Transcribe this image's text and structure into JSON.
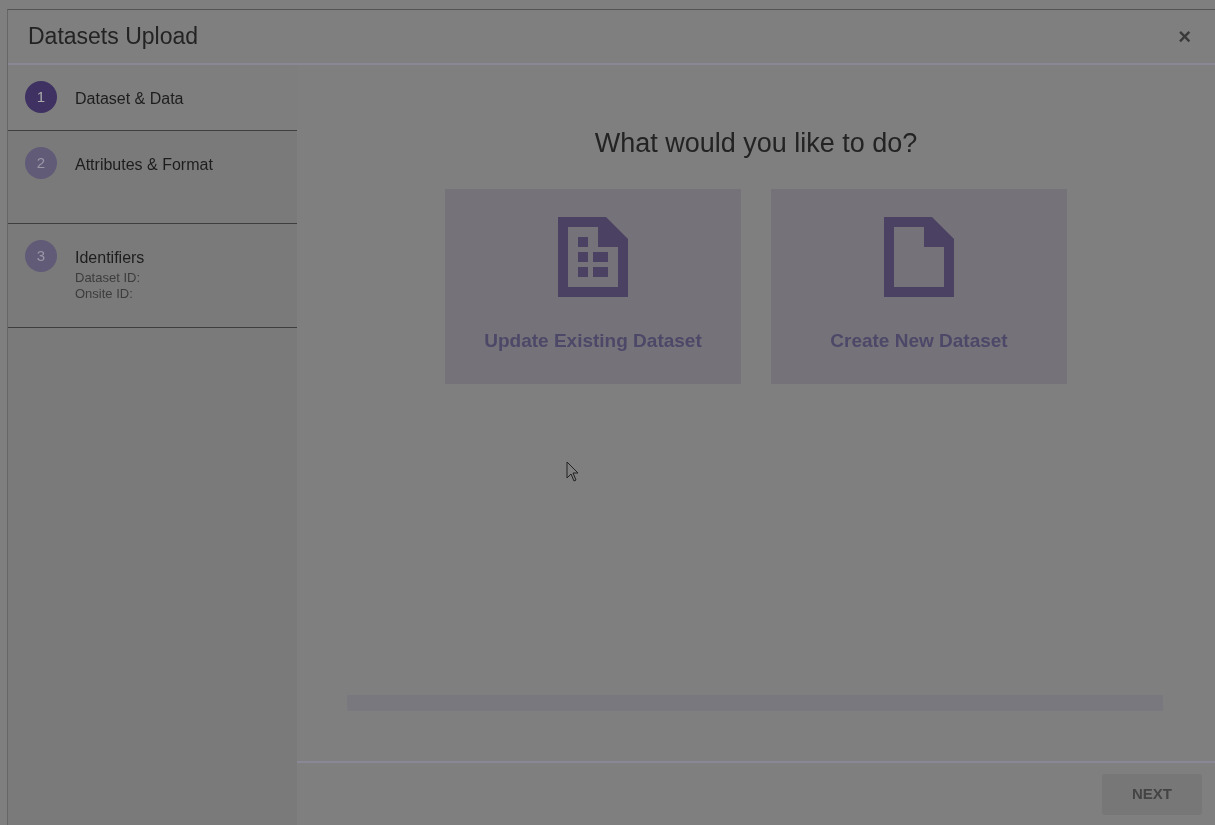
{
  "window": {
    "title": "Datasets Upload",
    "close": "×"
  },
  "steps": [
    {
      "number": "1",
      "label": "Dataset & Data",
      "selected": true
    },
    {
      "number": "2",
      "label": "Attributes & Format",
      "selected": false
    },
    {
      "number": "3",
      "label": "Identifiers",
      "selected": false,
      "details": [
        "Dataset ID:",
        "Onsite ID:"
      ]
    }
  ],
  "main": {
    "heading": "What would you like to do?",
    "options": [
      {
        "kind": "table",
        "label": "Update Existing Dataset"
      },
      {
        "kind": "blank",
        "label": "Create New Dataset"
      }
    ]
  },
  "footer": {
    "next": {
      "label": "NEXT",
      "disabled": true
    }
  }
}
